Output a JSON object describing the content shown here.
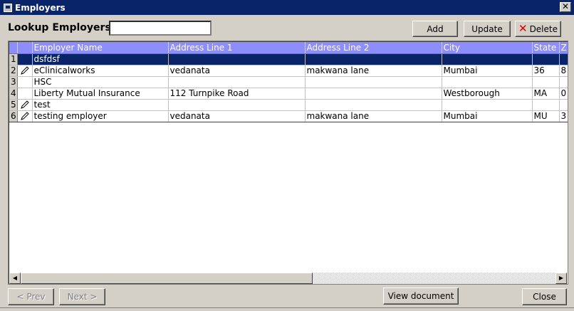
{
  "window": {
    "title": "Employers",
    "close_glyph": "✕"
  },
  "lookup": {
    "label": "Lookup Employers",
    "value": ""
  },
  "toolbar": {
    "add_label": "Add",
    "update_label": "Update",
    "delete_label": "Delete"
  },
  "grid": {
    "columns": [
      "Employer Name",
      "Address Line 1",
      "Address Line 2",
      "City",
      "State",
      "Z"
    ],
    "rows": [
      {
        "num": "1",
        "edited": false,
        "selected": true,
        "cells": [
          "dsfdsf",
          "",
          "",
          "",
          "",
          ""
        ]
      },
      {
        "num": "2",
        "edited": true,
        "selected": false,
        "cells": [
          "eClinicalworks",
          "vedanata",
          "makwana lane",
          "Mumbai",
          "36",
          "8"
        ]
      },
      {
        "num": "3",
        "edited": false,
        "selected": false,
        "cells": [
          "HSC",
          "",
          "",
          "",
          "",
          ""
        ]
      },
      {
        "num": "4",
        "edited": false,
        "selected": false,
        "cells": [
          "Liberty Mutual Insurance",
          "112 Turnpike Road",
          "",
          "Westborough",
          "MA",
          "0"
        ]
      },
      {
        "num": "5",
        "edited": true,
        "selected": false,
        "cells": [
          "test",
          "",
          "",
          "",
          "",
          ""
        ]
      },
      {
        "num": "6",
        "edited": true,
        "selected": false,
        "cells": [
          "testing employer",
          "vedanata",
          "makwana lane",
          "Mumbai",
          "MU",
          "3"
        ]
      }
    ]
  },
  "footer": {
    "prev_label": "< Prev",
    "next_label": "Next >",
    "view_document_label": "View document",
    "close_label": "Close"
  },
  "icons": {
    "edit_row": "pencil-icon",
    "delete": "x-icon"
  },
  "colors": {
    "title_bar": "#0a246a",
    "header": "#8d8dfb",
    "selection": "#0a246a",
    "face": "#d4d0c8"
  }
}
